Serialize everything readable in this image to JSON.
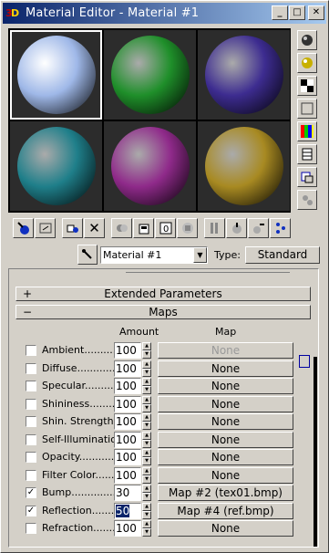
{
  "window": {
    "title": "Material Editor - Material #1"
  },
  "slots": [
    {
      "name": "white",
      "color": "#9fb8e8"
    },
    {
      "name": "green",
      "color": "#1f8f2a"
    },
    {
      "name": "indigo",
      "color": "#3d2c90"
    },
    {
      "name": "teal",
      "color": "#1f7f8a"
    },
    {
      "name": "magenta",
      "color": "#8f2a8a"
    },
    {
      "name": "gold",
      "color": "#a88a22"
    }
  ],
  "material": {
    "name": "Material #1",
    "type_label": "Type:",
    "type_value": "Standard"
  },
  "rollouts": {
    "extended": {
      "sign": "+",
      "title": "Extended Parameters"
    },
    "maps": {
      "sign": "−",
      "title": "Maps",
      "col_amount": "Amount",
      "col_map": "Map"
    }
  },
  "maps": [
    {
      "label": "Ambient.............",
      "checked": false,
      "amount": "100",
      "map": "None",
      "dim": true
    },
    {
      "label": "Diffuse...............",
      "checked": false,
      "amount": "100",
      "map": "None",
      "dim": false
    },
    {
      "label": "Specular...........",
      "checked": false,
      "amount": "100",
      "map": "None",
      "dim": false
    },
    {
      "label": "Shininess..........",
      "checked": false,
      "amount": "100",
      "map": "None",
      "dim": false
    },
    {
      "label": "Shin. Strength...",
      "checked": false,
      "amount": "100",
      "map": "None",
      "dim": false
    },
    {
      "label": "Self-Illumination.",
      "checked": false,
      "amount": "100",
      "map": "None",
      "dim": false
    },
    {
      "label": "Opacity.............",
      "checked": false,
      "amount": "100",
      "map": "None",
      "dim": false
    },
    {
      "label": "Filter Color.........",
      "checked": false,
      "amount": "100",
      "map": "None",
      "dim": false
    },
    {
      "label": "Bump.................",
      "checked": true,
      "amount": "30",
      "map": "Map #2 (tex01.bmp)",
      "dim": false
    },
    {
      "label": "Reflection..........",
      "checked": true,
      "amount": "50",
      "map": "Map #4 (ref.bmp)",
      "dim": false,
      "selected": true
    },
    {
      "label": "Refraction..........",
      "checked": false,
      "amount": "100",
      "map": "None",
      "dim": false
    }
  ],
  "icons": {
    "rtools": [
      "sample-type-icon",
      "backlight-icon",
      "background-icon",
      "tiling-icon",
      "video-check-icon",
      "make-preview-icon",
      "options-icon",
      "select-by-material-icon"
    ],
    "btools": [
      "get-material-icon",
      "put-to-scene-icon",
      "assign-material-icon",
      "reset-icon",
      "copy-material-icon",
      "put-to-library-icon",
      "effects-channel-icon",
      "show-map-icon",
      "show-end-result-icon",
      "go-to-parent-icon",
      "go-forward-icon",
      "material-navigator-icon"
    ]
  }
}
